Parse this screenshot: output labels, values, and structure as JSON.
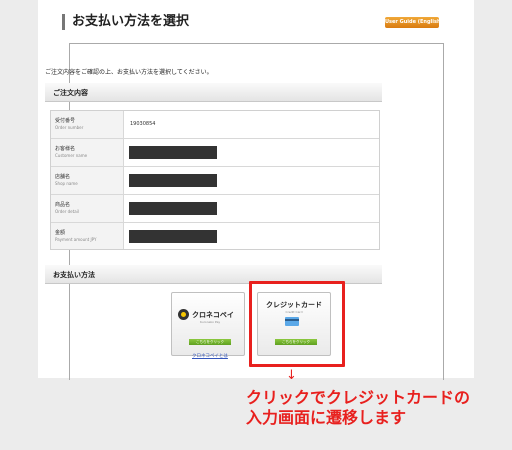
{
  "page": {
    "title": "お支払い方法を選択",
    "guide_button": "User Guide (English)",
    "intro": "ご注文内容をご確認の上、お支払い方法を選択してください。"
  },
  "order": {
    "heading": "ご注文内容",
    "rows": [
      {
        "label": "受付番号",
        "label_en": "Order number",
        "value": "19030854"
      },
      {
        "label": "お客様名",
        "label_en": "Customer name",
        "value": ""
      },
      {
        "label": "店舗名",
        "label_en": "Shop name",
        "value": ""
      },
      {
        "label": "商品名",
        "label_en": "Order detail",
        "value": ""
      },
      {
        "label": "金額",
        "label_en": "Payment amount JPY",
        "value": ""
      }
    ]
  },
  "payment": {
    "heading": "お支払い方法",
    "kuroneko": {
      "name": "クロネコペイ",
      "sub": "Kuroneko Pay",
      "button": "こちらをクリック",
      "link": "クロネコペイとは"
    },
    "credit": {
      "name": "クレジットカード",
      "sub": "Credit Card",
      "button": "こちらをクリック"
    }
  },
  "annotation": {
    "arrow": "↓",
    "line1": "クリックでクレジットカードの",
    "line2": "入力画面に遷移します",
    "color": "#e8201e"
  }
}
